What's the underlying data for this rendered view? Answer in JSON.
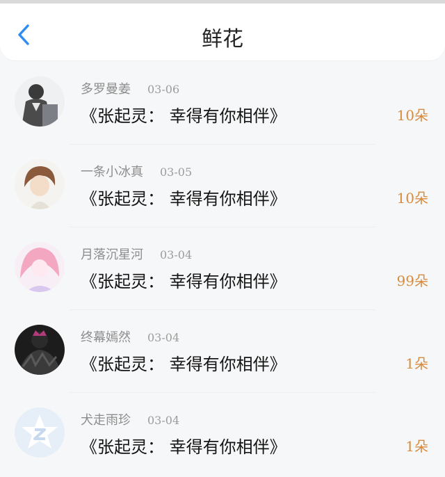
{
  "header": {
    "title": "鲜花",
    "back_icon": "chevron-left-icon"
  },
  "entries": [
    {
      "name": "多罗曼姜",
      "date": "03-06",
      "book": "《张起灵： 幸得有你相伴》",
      "count": "10朵",
      "avatar": "avatar-suit-figure"
    },
    {
      "name": "一条小冰真",
      "date": "03-05",
      "book": "《张起灵： 幸得有你相伴》",
      "count": "10朵",
      "avatar": "avatar-anime-brown-hair"
    },
    {
      "name": "月落沉星河",
      "date": "03-04",
      "book": "《张起灵： 幸得有你相伴》",
      "count": "99朵",
      "avatar": "avatar-pink-hair"
    },
    {
      "name": "终幕嫣然",
      "date": "03-04",
      "book": "《张起灵： 幸得有你相伴》",
      "count": "1朵",
      "avatar": "avatar-dark-masked"
    },
    {
      "name": "犬走雨珍",
      "date": "03-04",
      "book": "《张起灵： 幸得有你相伴》",
      "count": "1朵",
      "avatar": "avatar-default-star-z"
    }
  ],
  "colors": {
    "accent": "#2f8cf0",
    "count": "#d88a3d"
  }
}
